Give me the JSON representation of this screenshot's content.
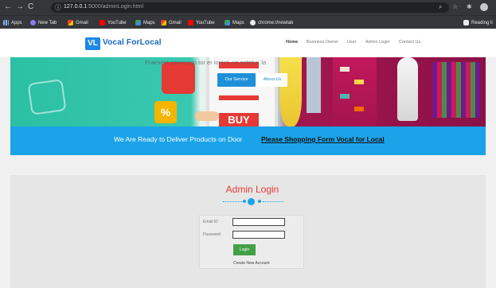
{
  "browser": {
    "url_host": "127.0.0.1",
    "url_path": ":5000/adminLogin.html",
    "bookmarks": [
      "Apps",
      "New Tab",
      "Gmail",
      "YouTube",
      "Maps",
      "Gmail",
      "YouTube",
      "Maps",
      "chrome://newtab"
    ],
    "reading_list": "Reading li"
  },
  "site": {
    "logo_mark": "VL",
    "logo_name": "Vocal ForLocal",
    "nav": [
      "Home",
      "Business Owner",
      "User",
      "Admin Login",
      "Contact Us"
    ]
  },
  "hero": {
    "text": "Praesent commodo tor      er      ioreet, ve      ectetur, la",
    "service_button": "Our Service",
    "about_button": "About Us",
    "buy_sign": "BUY",
    "percent_sign": "%"
  },
  "banner": {
    "text": "We Are Ready to Deliver Products on Door",
    "link": "Please Shopping Form Vocal for Local"
  },
  "login": {
    "title": "Admin Login",
    "email_label": "Email ID",
    "password_label": "Password",
    "button": "Login",
    "create_link": "Create New Account"
  },
  "colors": {
    "accent": "#1aa3e8",
    "title_red": "#e53935",
    "login_green": "#43a047"
  }
}
